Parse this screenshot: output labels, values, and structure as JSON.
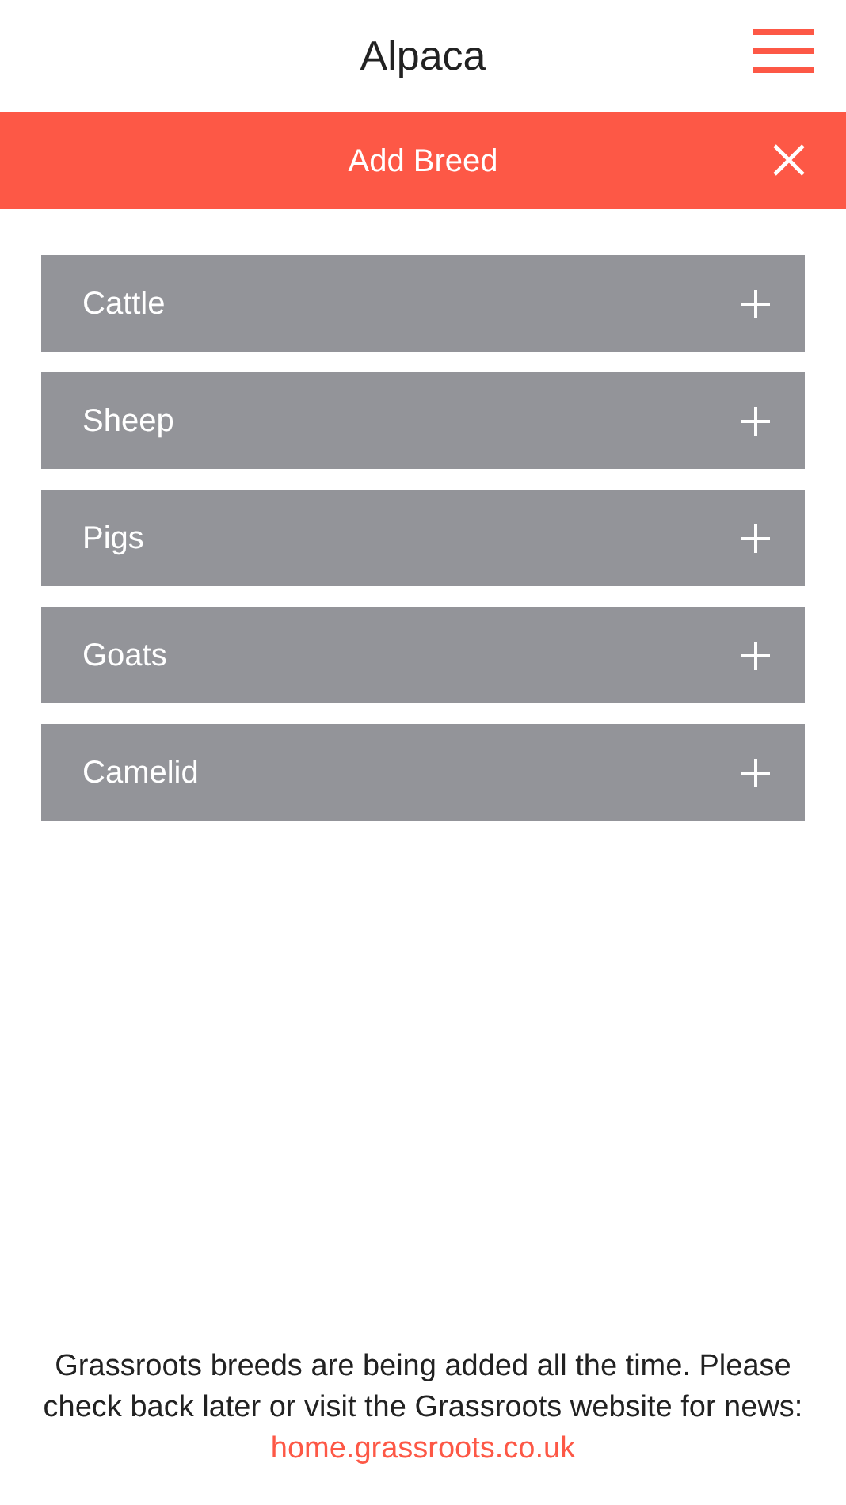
{
  "header": {
    "title": "Alpaca"
  },
  "banner": {
    "title": "Add Breed"
  },
  "categories": [
    {
      "label": "Cattle",
      "expanded": false
    },
    {
      "label": "Sheep",
      "expanded": false
    },
    {
      "label": "Pigs",
      "expanded": false
    },
    {
      "label": "Goats",
      "expanded": false
    },
    {
      "label": "Camelid",
      "expanded": false
    }
  ],
  "footer": {
    "text": "Grassroots breeds are being added all the time. Please check back later or visit the Grassroots website for news:",
    "link": "home.grassroots.co.uk"
  }
}
